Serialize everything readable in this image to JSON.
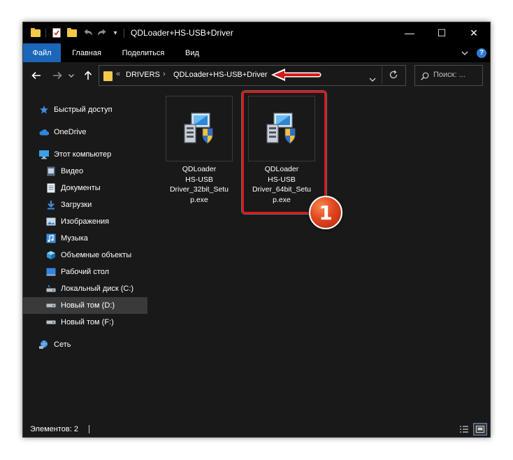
{
  "window": {
    "title": "QDLoader+HS-USB+Driver",
    "controls": {
      "minimize": "—",
      "maximize": "☐",
      "close": "✕"
    }
  },
  "ribbon": {
    "tabs": [
      {
        "label": "Файл",
        "active": true
      },
      {
        "label": "Главная",
        "active": false
      },
      {
        "label": "Поделиться",
        "active": false
      },
      {
        "label": "Вид",
        "active": false
      }
    ],
    "accent_color": "#1a66b8"
  },
  "address_bar": {
    "overflow_indicator": "«",
    "path": [
      "DRIVERS",
      "QDLoader+HS-USB+Driver"
    ],
    "separator": "›"
  },
  "search": {
    "placeholder": "Поиск: ..."
  },
  "sidebar": {
    "items": [
      {
        "label": "Быстрый доступ",
        "icon": "star-icon"
      },
      {
        "label": "OneDrive",
        "icon": "cloud-icon"
      },
      {
        "label": "Этот компьютер",
        "icon": "computer-icon"
      },
      {
        "label": "Видео",
        "icon": "video-icon"
      },
      {
        "label": "Документы",
        "icon": "document-icon"
      },
      {
        "label": "Загрузки",
        "icon": "download-icon"
      },
      {
        "label": "Изображения",
        "icon": "image-icon"
      },
      {
        "label": "Музыка",
        "icon": "music-icon"
      },
      {
        "label": "Объемные объекты",
        "icon": "cube-icon"
      },
      {
        "label": "Рабочий стол",
        "icon": "desktop-icon"
      },
      {
        "label": "Локальный диск (C:)",
        "icon": "drive-c-icon"
      },
      {
        "label": "Новый том (D:)",
        "icon": "drive-icon",
        "selected": true
      },
      {
        "label": "Новый том (F:)",
        "icon": "drive-icon"
      },
      {
        "label": "Сеть",
        "icon": "network-icon"
      }
    ]
  },
  "files": [
    {
      "name_lines": [
        "QDLoader",
        "HS-USB",
        "Driver_32bit_Setu",
        "p.exe"
      ]
    },
    {
      "name_lines": [
        "QDLoader",
        "HS-USB",
        "Driver_64bit_Setu",
        "p.exe"
      ],
      "highlighted": true
    }
  ],
  "annotation": {
    "badge_number": "1",
    "highlight_color": "#d61a1a"
  },
  "status_bar": {
    "text": "Элементов: 2"
  }
}
